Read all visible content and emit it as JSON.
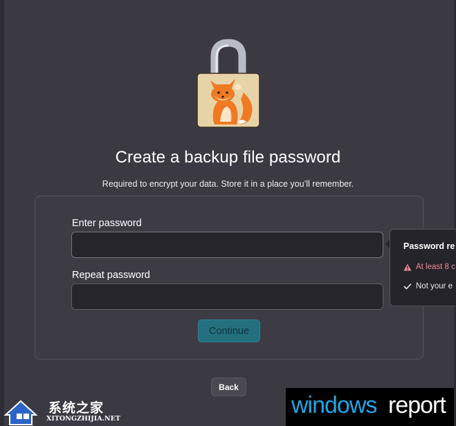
{
  "page": {
    "title": "Create a backup file password",
    "subtitle": "Required to encrypt your data. Store it in a place you’ll remember."
  },
  "form": {
    "password_label": "Enter password",
    "password_value": "",
    "repeat_label": "Repeat password",
    "repeat_value": "",
    "continue_label": "Continue"
  },
  "back_label": "Back",
  "requirements": {
    "title": "Password re",
    "items": [
      {
        "text": "At least 8 c",
        "status": "warning",
        "color": "#f08a8f"
      },
      {
        "text": "Not your e",
        "status": "ok",
        "color": "#e8e8ea"
      }
    ]
  },
  "watermarks": {
    "left_cn": "系统之家",
    "left_en": "XITONGZHIJIA.NET",
    "right_part1": "windows",
    "right_part2": "report"
  },
  "colors": {
    "background": "#3b3a43",
    "accent": "#24707f",
    "warning": "#f08a8f"
  }
}
